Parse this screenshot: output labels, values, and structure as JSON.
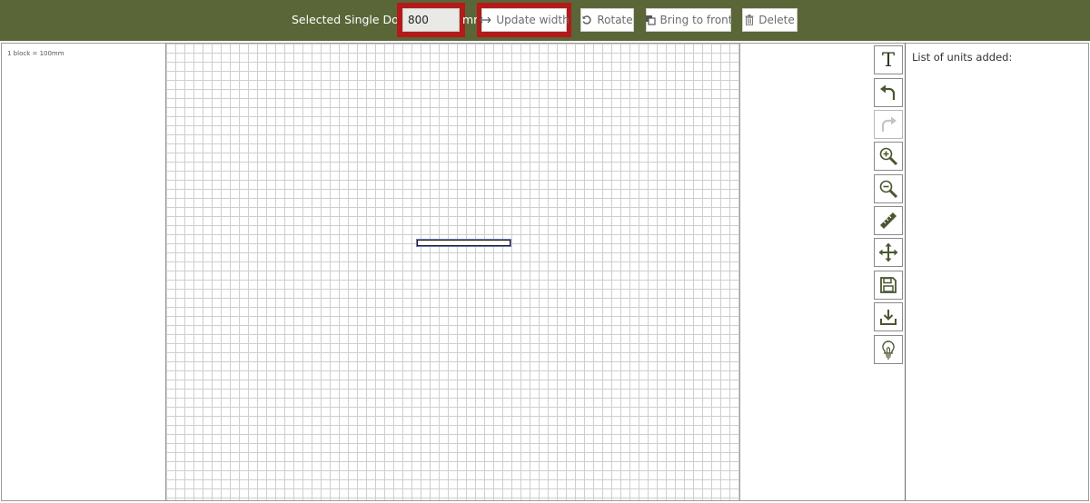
{
  "toolbar": {
    "selected_label": "Selected Single Door",
    "width_value": "800",
    "unit_label": "mm",
    "update_width_label": "Update width",
    "rotate_label": "Rotate",
    "bring_to_front_label": "Bring to front",
    "delete_label": "Delete"
  },
  "canvas": {
    "scale_label": "1 block = 100mm"
  },
  "tools": [
    {
      "name": "text-tool",
      "icon": "text-T-icon"
    },
    {
      "name": "undo-tool",
      "icon": "undo-arrow-icon"
    },
    {
      "name": "redo-tool",
      "icon": "redo-arrow-icon",
      "disabled": true
    },
    {
      "name": "zoom-in-tool",
      "icon": "zoom-in-icon"
    },
    {
      "name": "zoom-out-tool",
      "icon": "zoom-out-icon"
    },
    {
      "name": "measure-tool",
      "icon": "ruler-icon"
    },
    {
      "name": "pan-tool",
      "icon": "move-arrows-icon"
    },
    {
      "name": "save-tool",
      "icon": "floppy-disk-icon"
    },
    {
      "name": "download-tool",
      "icon": "download-tray-icon"
    },
    {
      "name": "tips-tool",
      "icon": "lightbulb-icon"
    }
  ],
  "units_panel": {
    "title": "List of units added:"
  },
  "colors": {
    "topbar": "#5a6638",
    "highlight": "#b41a1a",
    "icon": "#5a6638"
  }
}
